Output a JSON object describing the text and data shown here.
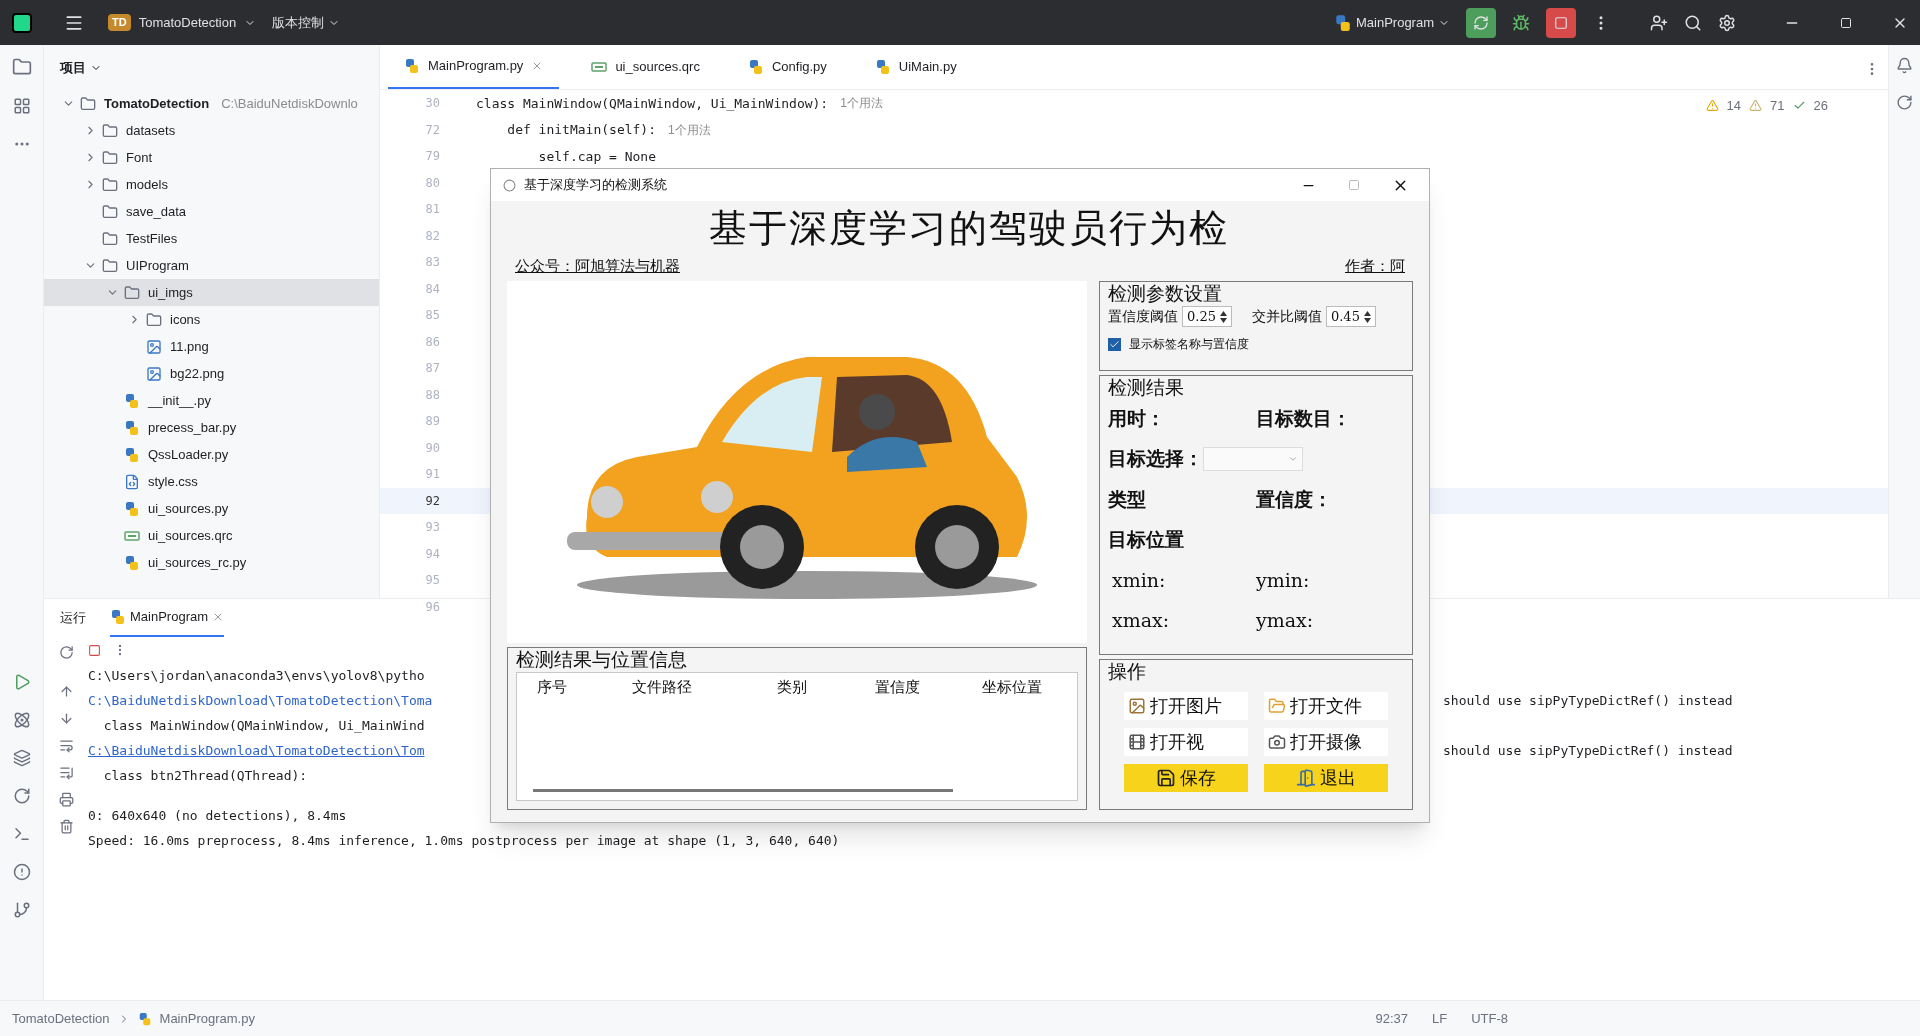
{
  "title_bar": {
    "project_badge": "TD",
    "project": "TomatoDetection",
    "vcs": "版本控制",
    "run_config": "MainProgram"
  },
  "project_panel": {
    "title": "项目",
    "tree": [
      {
        "name": "TomatoDetection",
        "path": "C:\\BaiduNetdiskDownlo",
        "kind": "folder",
        "expanded": true,
        "selected": false,
        "children": [
          {
            "name": "datasets",
            "kind": "folder",
            "expanded": false,
            "selected": false
          },
          {
            "name": "Font",
            "kind": "folder",
            "expanded": false,
            "selected": false
          },
          {
            "name": "models",
            "kind": "folder",
            "expanded": false,
            "selected": false
          },
          {
            "name": "save_data",
            "kind": "folder",
            "selected": false
          },
          {
            "name": "TestFiles",
            "kind": "folder",
            "selected": false
          },
          {
            "name": "UIProgram",
            "kind": "folder",
            "expanded": true,
            "selected": false,
            "children": [
              {
                "name": "ui_imgs",
                "kind": "folder",
                "expanded": true,
                "selected": true,
                "children": [
                  {
                    "name": "icons",
                    "kind": "folder",
                    "expanded": false,
                    "selected": false
                  },
                  {
                    "name": "11.png",
                    "kind": "image",
                    "selected": false
                  },
                  {
                    "name": "bg22.png",
                    "kind": "image",
                    "selected": false
                  }
                ]
              },
              {
                "name": "__init__.py",
                "kind": "python",
                "selected": false
              },
              {
                "name": "precess_bar.py",
                "kind": "python",
                "selected": false
              },
              {
                "name": "QssLoader.py",
                "kind": "python",
                "selected": false
              },
              {
                "name": "style.css",
                "kind": "css",
                "selected": false
              },
              {
                "name": "ui_sources.py",
                "kind": "python",
                "selected": false
              },
              {
                "name": "ui_sources.qrc",
                "kind": "qrc",
                "selected": false
              },
              {
                "name": "ui_sources_rc.py",
                "kind": "python",
                "selected": false
              }
            ]
          }
        ]
      }
    ]
  },
  "editor": {
    "tabs": [
      {
        "label": "MainProgram.py",
        "kind": "python",
        "selected": true
      },
      {
        "label": "ui_sources.qrc",
        "kind": "qrc",
        "selected": false
      },
      {
        "label": "Config.py",
        "kind": "python",
        "selected": false
      },
      {
        "label": "UiMain.py",
        "kind": "python",
        "selected": false
      }
    ],
    "inspections": {
      "warnings": "14",
      "weak_warnings": "71",
      "typos": "26"
    },
    "lines": [
      {
        "number": "30",
        "code": "class MainWindow(QMainWindow, Ui_MainWindow):",
        "hint": "1个用法",
        "current": false
      },
      {
        "number": "72",
        "code": "    def initMain(self):",
        "hint": "1个用法",
        "current": false
      },
      {
        "number": "79",
        "code": "        self.cap = None",
        "current": false
      },
      {
        "number": "80",
        "current": false
      },
      {
        "number": "81",
        "current": false
      },
      {
        "number": "82",
        "current": false
      },
      {
        "number": "83",
        "current": false
      },
      {
        "number": "84",
        "current": false
      },
      {
        "number": "85",
        "current": false
      },
      {
        "number": "86",
        "current": false
      },
      {
        "number": "87",
        "current": false
      },
      {
        "number": "88",
        "current": false
      },
      {
        "number": "89",
        "current": false
      },
      {
        "number": "90",
        "current": false
      },
      {
        "number": "91",
        "current": false
      },
      {
        "number": "92",
        "current": true
      },
      {
        "number": "93",
        "current": false
      },
      {
        "number": "94",
        "current": false
      },
      {
        "number": "95",
        "current": false
      },
      {
        "number": "96",
        "current": false
      }
    ]
  },
  "run_panel": {
    "title": "运行",
    "tab": "MainProgram",
    "lines": [
      {
        "text": "C:\\Users\\jordan\\anaconda3\\envs\\yolov8\\pytho",
        "kind": "plain",
        "blank_before": false
      },
      {
        "text": "C:\\BaiduNetdiskDownload\\TomatoDetection\\Toma",
        "right": "should use sipPyTypeDictRef() instead",
        "kind": "path",
        "blank_before": false
      },
      {
        "text": "  class MainWindow(QMainWindow, Ui_MainWind",
        "kind": "plain",
        "blank_before": false
      },
      {
        "text": "C:\\BaiduNetdiskDownload\\TomatoDetection\\Tom",
        "right": "should use sipPyTypeDictRef() instead",
        "kind": "link",
        "blank_before": false
      },
      {
        "text": "  class btn2Thread(QThread):",
        "kind": "plain",
        "blank_before": false
      },
      {
        "text": "0: 640x640 (no detections), 8.4ms",
        "kind": "plain",
        "blank_before": true
      },
      {
        "text": "Speed: 16.0ms preprocess, 8.4ms inference, 1.0ms postprocess per image at shape (1, 3, 640, 640)",
        "kind": "plain",
        "blank_before": false
      }
    ]
  },
  "status_bar": {
    "breadcrumbs": [
      "TomatoDetection",
      "MainProgram.py"
    ],
    "position": "92:37",
    "line_separator": "LF",
    "encoding": "UTF-8"
  },
  "dialog": {
    "title": "基于深度学习的检测系统",
    "heading": "基于深度学习的驾驶员行为检",
    "account": "公众号：阿旭算法与机器",
    "author": "作者：阿",
    "params": {
      "title": "检测参数设置",
      "conf_label": "置信度阈值",
      "conf_value": "0.25",
      "iou_label": "交并比阈值",
      "iou_value": "0.45",
      "show_labels": "显示标签名称与置信度",
      "show_labels_checked": true
    },
    "results": {
      "title": "检测结果",
      "time": "用时：",
      "count": "目标数目：",
      "select": "目标选择：",
      "type": "类型",
      "confidence": "置信度：",
      "position": "目标位置",
      "xmin": "xmin:",
      "ymin": "ymin:",
      "xmax": "xmax:",
      "ymax": "ymax:"
    },
    "table": {
      "title": "检测结果与位置信息",
      "columns": [
        "序号",
        "文件路径",
        "类别",
        "置信度",
        "坐标位置"
      ]
    },
    "actions": {
      "title": "操作",
      "buttons": [
        {
          "label": "打开图片",
          "kind": "image"
        },
        {
          "label": "打开文件",
          "kind": "folder"
        },
        {
          "label": "打开视",
          "kind": "video"
        },
        {
          "label": "打开摄像",
          "kind": "camera"
        },
        {
          "label": "保存",
          "kind": "save"
        },
        {
          "label": "退出",
          "kind": "exit"
        }
      ]
    }
  }
}
